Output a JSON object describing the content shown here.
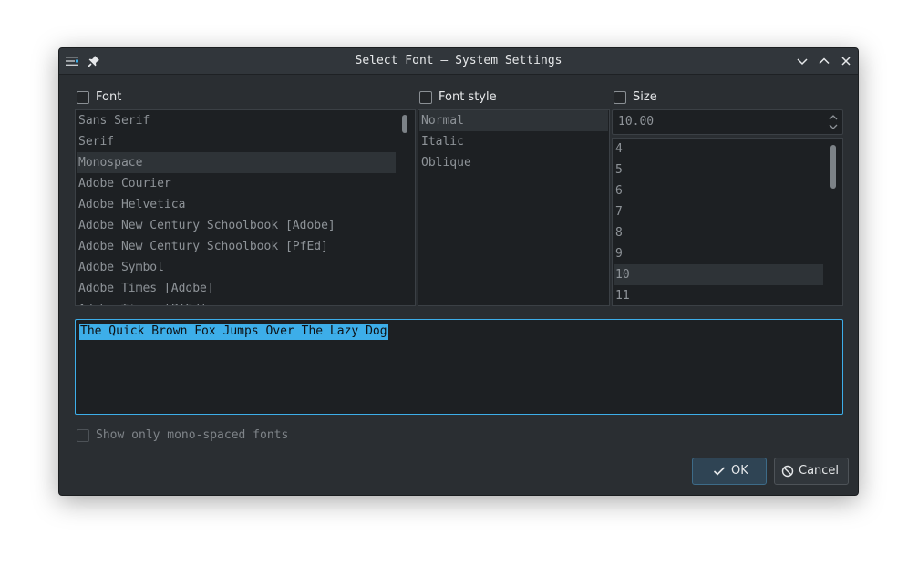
{
  "window": {
    "title": "Select Font — System Settings"
  },
  "font": {
    "label": "Font",
    "items": [
      "Sans Serif",
      "Serif",
      "Monospace",
      "Adobe Courier",
      "Adobe Helvetica",
      "Adobe New Century Schoolbook [Adobe]",
      "Adobe New Century Schoolbook [PfEd]",
      "Adobe Symbol",
      "Adobe Times [Adobe]",
      "Adobe Times [PfEd]"
    ],
    "selected": "Monospace"
  },
  "style": {
    "label": "Font style",
    "items": [
      "Normal",
      "Italic",
      "Oblique"
    ],
    "selected": "Normal"
  },
  "size": {
    "label": "Size",
    "value": "10.00",
    "items": [
      "4",
      "5",
      "6",
      "7",
      "8",
      "9",
      "10",
      "11"
    ],
    "selected": "10"
  },
  "preview": {
    "text": "The Quick Brown Fox Jumps Over The Lazy Dog"
  },
  "mono_only": {
    "label": "Show only mono-spaced fonts"
  },
  "buttons": {
    "ok": "OK",
    "cancel": "Cancel"
  },
  "colors": {
    "accent": "#3daee9",
    "background": "#2a2e32",
    "list_bg": "#1d2023"
  }
}
